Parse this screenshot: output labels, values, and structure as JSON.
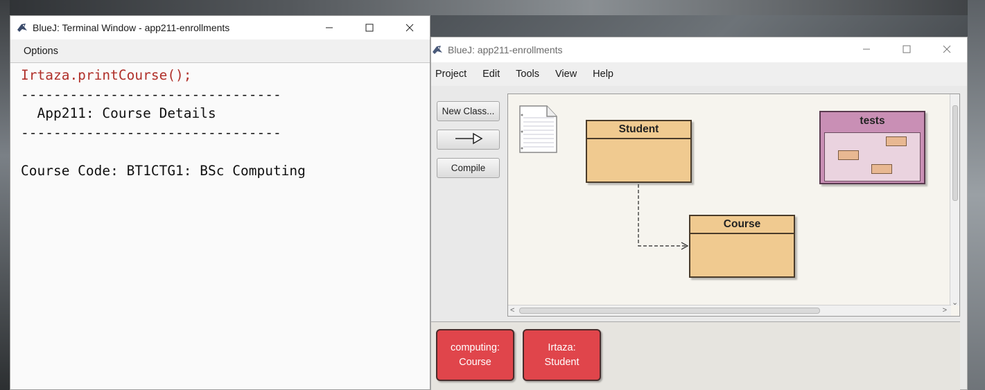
{
  "terminal": {
    "title": "BlueJ: Terminal Window - app211-enrollments",
    "menu": [
      "Options"
    ],
    "output_lines": [
      "Irtaza.printCourse();",
      "--------------------------------",
      "  App211: Course Details",
      "--------------------------------",
      "",
      "Course Code: BT1CTG1: BSc Computing"
    ]
  },
  "main": {
    "title": "BlueJ:  app211-enrollments",
    "menu": [
      "Project",
      "Edit",
      "Tools",
      "View",
      "Help"
    ],
    "buttons": {
      "new_class": "New Class...",
      "compile": "Compile"
    },
    "classes": [
      "Student",
      "Course"
    ],
    "package": "tests",
    "objects": [
      {
        "name": "computing:",
        "type": "Course"
      },
      {
        "name": "Irtaza:",
        "type": "Student"
      }
    ],
    "scroll_left": "<",
    "scroll_right": ">",
    "scroll_down": "⌄"
  },
  "colors": {
    "class_fill": "#f0ca90",
    "package_fill": "#c98fb5",
    "object_fill": "#e0454b",
    "command_text": "#b0302a"
  }
}
